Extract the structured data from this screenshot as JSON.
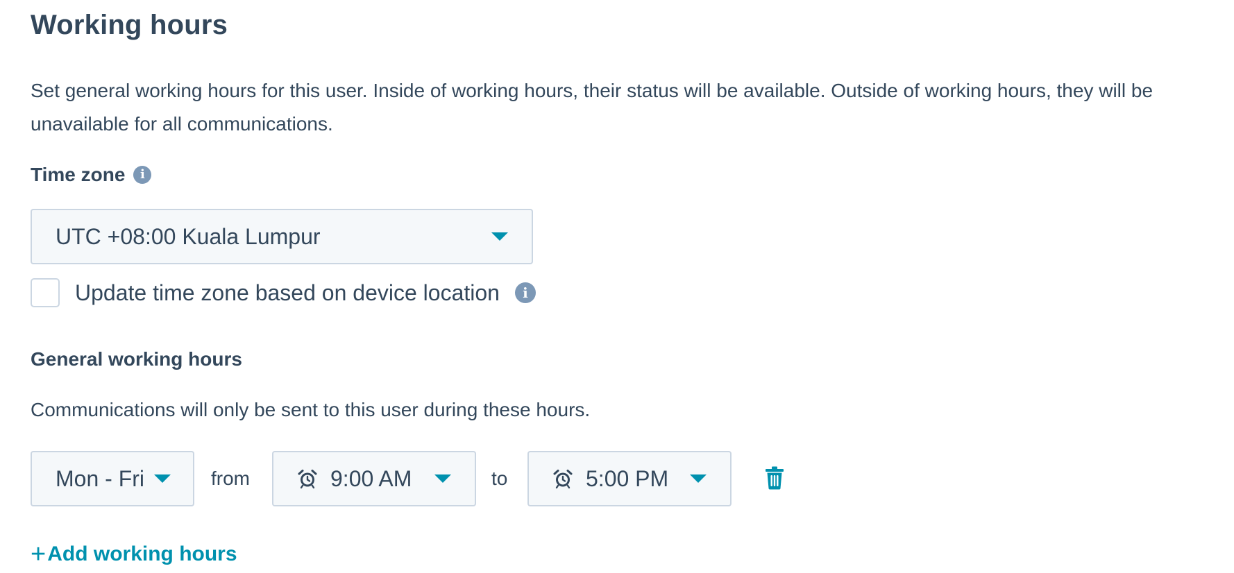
{
  "page": {
    "title": "Working hours",
    "description": "Set general working hours for this user. Inside of working hours, their status will be available. Outside of working hours, they will be unavailable for all communications."
  },
  "time_zone": {
    "label": "Time zone",
    "selected": "UTC +08:00 Kuala Lumpur",
    "update_checkbox_label": "Update time zone based on device location",
    "update_checked": false
  },
  "general_hours": {
    "label": "General working hours",
    "description": "Communications will only be sent to this user during these hours.",
    "rows": [
      {
        "days": "Mon - Fri",
        "from_label": "from",
        "start": "9:00 AM",
        "to_label": "to",
        "end": "5:00 PM"
      }
    ],
    "add_label": "Add working hours"
  },
  "icons": {
    "info": "info-icon",
    "clock": "alarm-clock-icon",
    "delete": "trash-icon",
    "dropdown": "caret-down-icon",
    "add": "plus-icon"
  },
  "colors": {
    "text": "#33475b",
    "accent": "#0091ae",
    "info_icon": "#7c98b6",
    "field_bg": "#f5f8fa",
    "field_border": "#cbd6e2"
  }
}
